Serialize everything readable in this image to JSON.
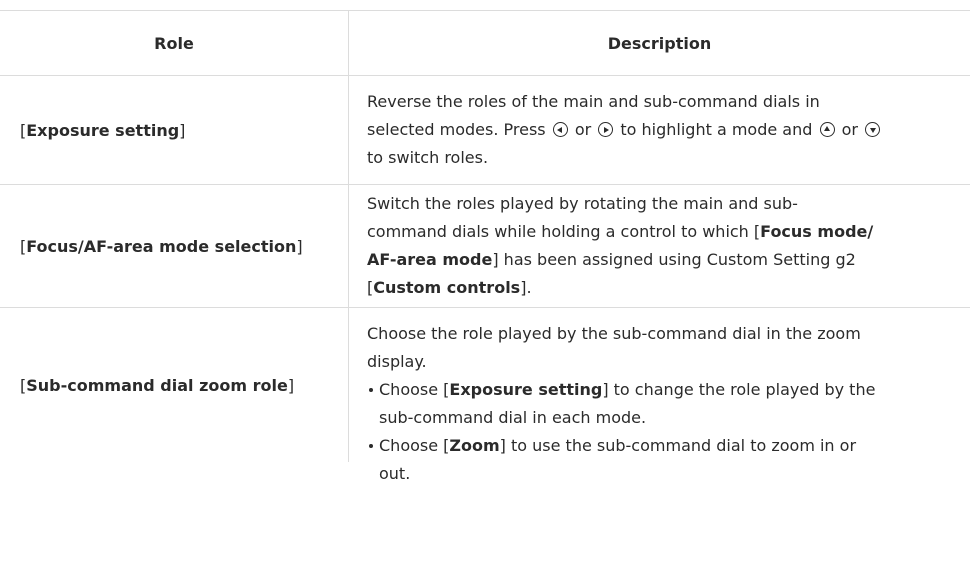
{
  "header": {
    "role": "Role",
    "description": "Description"
  },
  "rows": [
    {
      "role_open": "[",
      "role_bold": "Exposure setting",
      "role_close": "]",
      "desc": {
        "line1": "Reverse the roles of the main and sub-command dials in",
        "line2a": "selected modes. Press",
        "or1": "or",
        "line2b": "to highlight a mode and",
        "or2": "or",
        "line3": "to switch roles."
      }
    },
    {
      "role_open": "[",
      "role_bold": "Focus/AF-area mode selection",
      "role_close": "]",
      "desc": {
        "line1": "Switch the roles played by rotating the main and sub-",
        "line2a": "command dials while holding a control to which [",
        "line2bold": "Focus mode/",
        "line3bold": "AF-area mode",
        "line3b": "] has been assigned using Custom Setting g2",
        "line4a": "[",
        "line4bold": "Custom controls",
        "line4b": "]."
      }
    },
    {
      "role_open": "[",
      "role_bold": "Sub-command dial zoom role",
      "role_close": "]",
      "desc": {
        "intro1": "Choose the role played by the sub-command dial in the zoom",
        "intro2": "display.",
        "bullet1a": "Choose [",
        "bullet1bold": "Exposure setting",
        "bullet1b": "] to change the role played by the",
        "bullet1c": "sub-command dial in each mode.",
        "bullet2a": "Choose [",
        "bullet2bold": "Zoom",
        "bullet2b": "] to use the sub-command dial to zoom in or",
        "bullet2c": "out."
      }
    }
  ],
  "icons": [
    "multi-selector-left-icon",
    "multi-selector-right-icon",
    "multi-selector-up-icon",
    "multi-selector-down-icon"
  ]
}
